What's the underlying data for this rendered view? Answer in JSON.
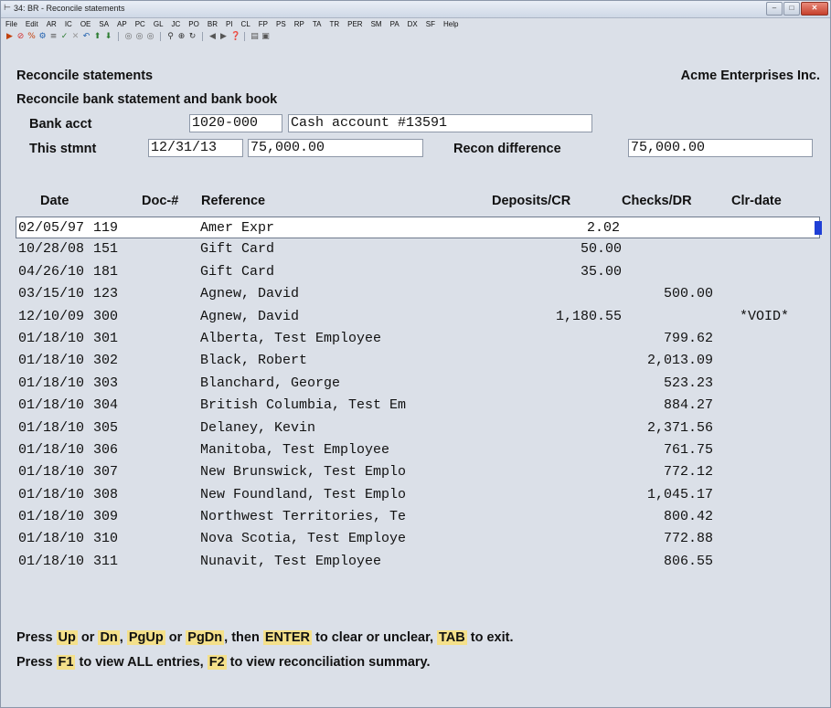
{
  "window": {
    "title": "34: BR - Reconcile statements",
    "icon": "app-icon",
    "buttons": [
      "minimize",
      "maximize",
      "close"
    ]
  },
  "menu": [
    "File",
    "Edit",
    "AR",
    "IC",
    "OE",
    "SA",
    "AP",
    "PC",
    "GL",
    "JC",
    "PO",
    "BR",
    "PI",
    "CL",
    "FP",
    "PS",
    "RP",
    "TA",
    "TR",
    "PER",
    "SM",
    "PA",
    "DX",
    "SF",
    "Help"
  ],
  "screen": {
    "title": "Reconcile statements",
    "company": "Acme Enterprises Inc.",
    "subtitle": "Reconcile bank statement and bank book",
    "bank_acct_label": "Bank acct",
    "bank_acct_value": "1020-000",
    "bank_acct_desc": "Cash account #13591",
    "this_stmnt_label": "This stmnt",
    "stmnt_date": "12/31/13",
    "stmnt_amount": "75,000.00",
    "recon_diff_label": "Recon difference",
    "recon_diff_value": "75,000.00"
  },
  "columns": {
    "date": "Date",
    "doc": "Doc-#",
    "reference": "Reference",
    "deposits": "Deposits/CR",
    "checks": "Checks/DR",
    "clr_date": "Clr-date"
  },
  "rows": [
    {
      "date": "02/05/97",
      "doc": "119",
      "ref": "Amer Expr",
      "dep": "2.02",
      "chk": "",
      "clr": ""
    },
    {
      "date": "10/28/08",
      "doc": "151",
      "ref": "Gift Card",
      "dep": "50.00",
      "chk": "",
      "clr": ""
    },
    {
      "date": "04/26/10",
      "doc": "181",
      "ref": "Gift Card",
      "dep": "35.00",
      "chk": "",
      "clr": ""
    },
    {
      "date": "03/15/10",
      "doc": "123",
      "ref": "Agnew, David",
      "dep": "",
      "chk": "500.00",
      "clr": ""
    },
    {
      "date": "12/10/09",
      "doc": "300",
      "ref": "Agnew, David",
      "dep": "1,180.55",
      "chk": "",
      "clr": "*VOID*"
    },
    {
      "date": "01/18/10",
      "doc": "301",
      "ref": "Alberta, Test Employee",
      "dep": "",
      "chk": "799.62",
      "clr": ""
    },
    {
      "date": "01/18/10",
      "doc": "302",
      "ref": "Black, Robert",
      "dep": "",
      "chk": "2,013.09",
      "clr": ""
    },
    {
      "date": "01/18/10",
      "doc": "303",
      "ref": "Blanchard, George",
      "dep": "",
      "chk": "523.23",
      "clr": ""
    },
    {
      "date": "01/18/10",
      "doc": "304",
      "ref": "British Columbia, Test Em",
      "dep": "",
      "chk": "884.27",
      "clr": ""
    },
    {
      "date": "01/18/10",
      "doc": "305",
      "ref": "Delaney, Kevin",
      "dep": "",
      "chk": "2,371.56",
      "clr": ""
    },
    {
      "date": "01/18/10",
      "doc": "306",
      "ref": "Manitoba, Test Employee",
      "dep": "",
      "chk": "761.75",
      "clr": ""
    },
    {
      "date": "01/18/10",
      "doc": "307",
      "ref": "New Brunswick, Test Emplo",
      "dep": "",
      "chk": "772.12",
      "clr": ""
    },
    {
      "date": "01/18/10",
      "doc": "308",
      "ref": "New Foundland, Test Emplo",
      "dep": "",
      "chk": "1,045.17",
      "clr": ""
    },
    {
      "date": "01/18/10",
      "doc": "309",
      "ref": "Northwest Territories, Te",
      "dep": "",
      "chk": "800.42",
      "clr": ""
    },
    {
      "date": "01/18/10",
      "doc": "310",
      "ref": "Nova Scotia, Test Employe",
      "dep": "",
      "chk": "772.88",
      "clr": ""
    },
    {
      "date": "01/18/10",
      "doc": "311",
      "ref": "Nunavit, Test Employee",
      "dep": "",
      "chk": "806.55",
      "clr": ""
    }
  ],
  "help": {
    "line1": {
      "press": "Press",
      "up": "Up",
      "or1": "or",
      "dn": "Dn",
      "comma": ",",
      "pgup": "PgUp",
      "or2": "or",
      "pgdn": "PgDn",
      "then": ", then",
      "enter": "ENTER",
      "clear": "to clear or unclear,",
      "tab": "TAB",
      "exit": "to exit."
    },
    "line2": {
      "press": "Press",
      "f1": "F1",
      "view_all": "to view ALL entries,",
      "f2": "F2",
      "view_summary": "to view reconciliation summary."
    }
  }
}
